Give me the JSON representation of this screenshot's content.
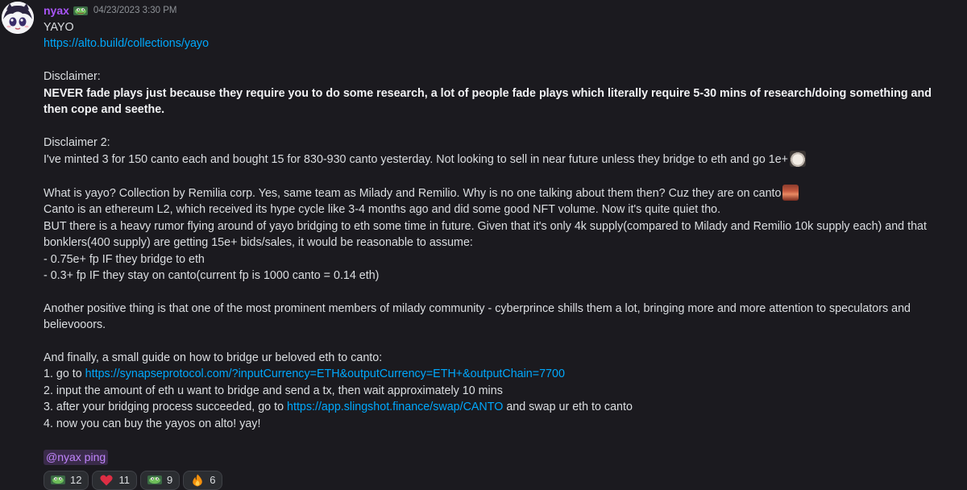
{
  "author": {
    "name": "nyax",
    "timestamp": "04/23/2023 3:30 PM",
    "badge_icon": "pepe-tag-icon"
  },
  "message": {
    "title": "YAYO",
    "link1": "https://alto.build/collections/yayo",
    "disclaimer1_heading": "Disclaimer:",
    "disclaimer1_bold": "NEVER fade plays just because they require you to do some research, a lot of people fade plays which literally require 5-30 mins of research/doing something and then cope and seethe.",
    "disclaimer2_heading": "Disclaimer 2:",
    "disclaimer2_text": "I've minted 3 for 150 canto each and bought 15 for 830-930 canto yesterday. Not looking to sell in near future unless they bridge to eth and go 1e+",
    "what_is": "What is yayo? Collection by Remilia corp. Yes, same team as Milady and Remilio. Why is no one talking about them then? Cuz they are on canto",
    "canto_desc": "Canto is an ethereum L2, which received its hype cycle like 3-4 months ago and did some good NFT volume. Now it's quite quiet tho.",
    "rumor": "BUT there is a heavy rumor flying around of yayo bridging to eth some time in future. Given that it's only 4k supply(compared to Milady and Remilio 10k supply each) and that bonklers(400 supply) are getting 15e+ bids/sales, it would be reasonable to assume:",
    "bullet1": "- 0.75e+ fp IF they bridge to eth",
    "bullet2": "- 0.3+ fp IF they stay on canto(current fp is 1000 canto = 0.14 eth)",
    "positive": "Another positive thing is that one of the most prominent members of milady community - cyberprince shills them a lot, bringing more and more attention to speculators and believooors.",
    "guide_intro": "And finally, a small guide on how to bridge ur beloved eth to canto:",
    "step1_prefix": "1. go to ",
    "step1_link": "https://synapseprotocol.com/?inputCurrency=ETH&outputCurrency=ETH+&outputChain=7700",
    "step2": "2. input the amount of eth u want to bridge and send a tx, then wait approximately 10 mins",
    "step3_prefix": "3. after your bridging process succeeded, go to ",
    "step3_link": "https://app.slingshot.finance/swap/CANTO",
    "step3_suffix": " and swap ur eth to canto",
    "step4": "4. now you can buy the yayos on alto! yay!",
    "mention": "@nyax ping"
  },
  "reactions": [
    {
      "icon": "pepe-tag-icon",
      "count": "12"
    },
    {
      "icon": "heart-icon",
      "count": "11"
    },
    {
      "icon": "pepe-tag-icon",
      "count": "9"
    },
    {
      "icon": "fire-icon",
      "count": "6"
    }
  ],
  "colors": {
    "background": "#1b1a1f",
    "username": "#a855f7",
    "link": "#00a8fc",
    "mention_bg": "#3a2b4a",
    "mention_text": "#c084fc"
  }
}
